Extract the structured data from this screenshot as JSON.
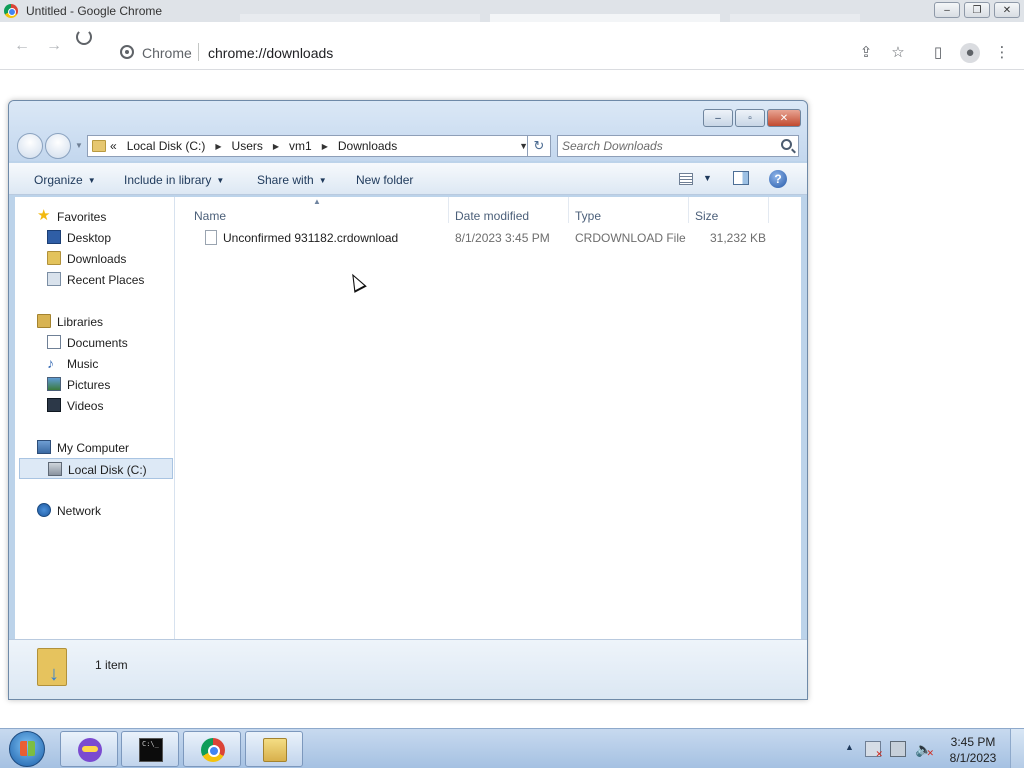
{
  "chrome": {
    "window_title": "Untitled - Google Chrome",
    "omnibox_origin": "Chrome",
    "omnibox_url": "chrome://downloads",
    "window_controls": {
      "minimize": "–",
      "restore": "❐",
      "close": "✕"
    }
  },
  "explorer": {
    "window_controls": {
      "minimize": "–",
      "maximize": "▫",
      "close": "✕"
    },
    "breadcrumbs": [
      "«",
      "Local Disk (C:)",
      "Users",
      "vm1",
      "Downloads"
    ],
    "search_placeholder": "Search Downloads",
    "commands": {
      "organize": "Organize",
      "include_in_library": "Include in library",
      "share_with": "Share with",
      "new_folder": "New folder",
      "help": "?"
    },
    "nav": {
      "favorites": {
        "label": "Favorites",
        "items": [
          "Desktop",
          "Downloads",
          "Recent Places"
        ]
      },
      "libraries": {
        "label": "Libraries",
        "items": [
          "Documents",
          "Music",
          "Pictures",
          "Videos"
        ]
      },
      "computer": {
        "label": "My Computer",
        "items": [
          "Local Disk (C:)"
        ]
      },
      "network": {
        "label": "Network"
      }
    },
    "columns": {
      "name": "Name",
      "date_modified": "Date modified",
      "type": "Type",
      "size": "Size"
    },
    "files": [
      {
        "name": "Unconfirmed 931182.crdownload",
        "date_modified": "8/1/2023 3:45 PM",
        "type": "CRDOWNLOAD File",
        "size": "31,232 KB"
      }
    ],
    "status": {
      "item_count": "1 item"
    }
  },
  "taskbar": {
    "time": "3:45 PM",
    "date": "8/1/2023",
    "cmd_glyph": "C:\\_"
  },
  "colors": {
    "chrome_titlebar": "#dfe3e8",
    "explorer_frame": "#bcd3ea",
    "taskbar": "#b5cde9",
    "selection": "#dde9f6"
  }
}
